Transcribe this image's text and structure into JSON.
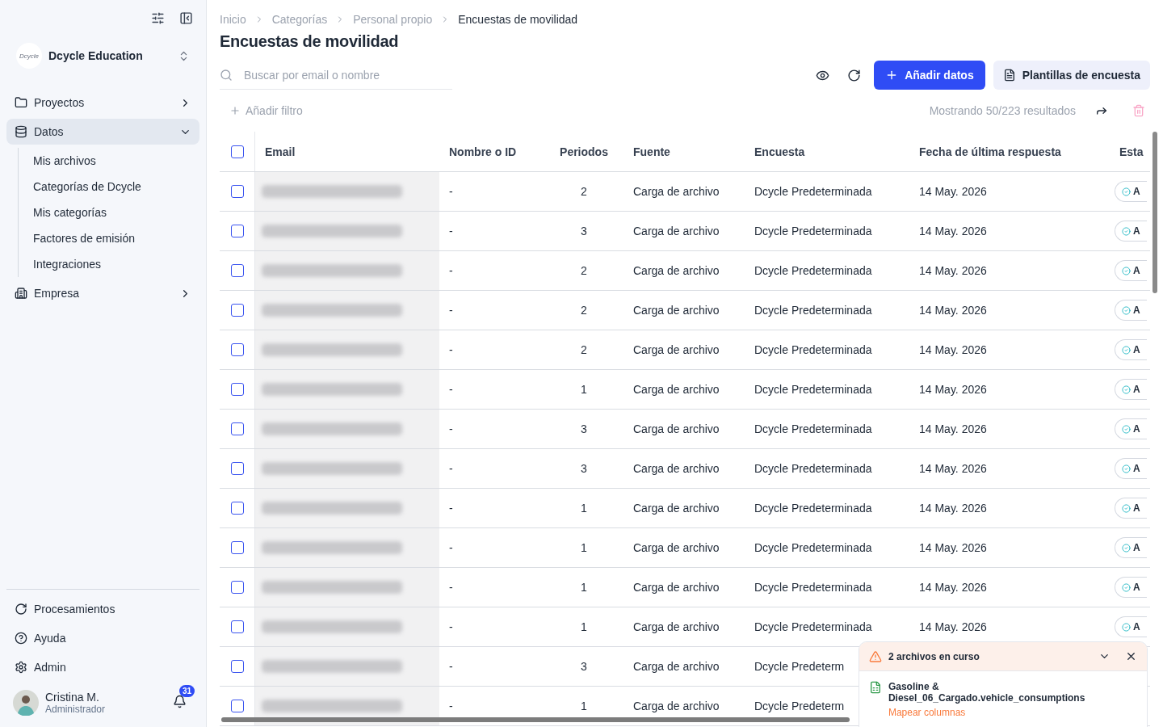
{
  "sidebar": {
    "org": {
      "logo_text": "Dcycle",
      "name": "Dcycle Education"
    },
    "nav": [
      {
        "label": "Proyectos",
        "kind": "folder",
        "expanded": false,
        "selected": false
      },
      {
        "label": "Datos",
        "kind": "database",
        "expanded": true,
        "selected": true,
        "children": [
          {
            "label": "Mis archivos"
          },
          {
            "label": "Categorías de Dcycle"
          },
          {
            "label": "Mis categorías"
          },
          {
            "label": "Factores de emisión"
          },
          {
            "label": "Integraciones"
          }
        ]
      },
      {
        "label": "Empresa",
        "kind": "building",
        "expanded": false,
        "selected": false
      }
    ],
    "bottom": [
      {
        "label": "Procesamientos",
        "kind": "refresh"
      },
      {
        "label": "Ayuda",
        "kind": "help"
      },
      {
        "label": "Admin",
        "kind": "settings"
      }
    ],
    "user": {
      "name": "Cristina M.",
      "role": "Administrador",
      "notifications": "31"
    }
  },
  "breadcrumb": [
    "Inicio",
    "Categorías",
    "Personal propio",
    "Encuestas de movilidad"
  ],
  "title": "Encuestas de movilidad",
  "search": {
    "placeholder": "Buscar por email o nombre"
  },
  "buttons": {
    "primary": "Añadir datos",
    "secondary": "Plantillas de encuesta"
  },
  "filter": "Añadir filtro",
  "results": "Mostrando 50/223 resultados",
  "table": {
    "select_all": false,
    "columns": [
      "Email",
      "Nombre o ID",
      "Periodos",
      "Fuente",
      "Encuesta",
      "Fecha de última respuesta",
      "Esta"
    ],
    "rows": [
      {
        "checked": false,
        "email_blurred": true,
        "name": "-",
        "periods": "2",
        "source": "Carga de archivo",
        "survey": "Dcycle Predeterminada",
        "date": "14 May. 2026",
        "status": "A"
      },
      {
        "checked": false,
        "email_blurred": true,
        "name": "-",
        "periods": "3",
        "source": "Carga de archivo",
        "survey": "Dcycle Predeterminada",
        "date": "14 May. 2026",
        "status": "A"
      },
      {
        "checked": false,
        "email_blurred": true,
        "name": "-",
        "periods": "2",
        "source": "Carga de archivo",
        "survey": "Dcycle Predeterminada",
        "date": "14 May. 2026",
        "status": "A"
      },
      {
        "checked": false,
        "email_blurred": true,
        "name": "-",
        "periods": "2",
        "source": "Carga de archivo",
        "survey": "Dcycle Predeterminada",
        "date": "14 May. 2026",
        "status": "A"
      },
      {
        "checked": false,
        "email_blurred": true,
        "name": "-",
        "periods": "2",
        "source": "Carga de archivo",
        "survey": "Dcycle Predeterminada",
        "date": "14 May. 2026",
        "status": "A"
      },
      {
        "checked": false,
        "email_blurred": true,
        "name": "-",
        "periods": "1",
        "source": "Carga de archivo",
        "survey": "Dcycle Predeterminada",
        "date": "14 May. 2026",
        "status": "A"
      },
      {
        "checked": false,
        "email_blurred": true,
        "name": "-",
        "periods": "3",
        "source": "Carga de archivo",
        "survey": "Dcycle Predeterminada",
        "date": "14 May. 2026",
        "status": "A"
      },
      {
        "checked": false,
        "email_blurred": true,
        "name": "-",
        "periods": "3",
        "source": "Carga de archivo",
        "survey": "Dcycle Predeterminada",
        "date": "14 May. 2026",
        "status": "A"
      },
      {
        "checked": false,
        "email_blurred": true,
        "name": "-",
        "periods": "1",
        "source": "Carga de archivo",
        "survey": "Dcycle Predeterminada",
        "date": "14 May. 2026",
        "status": "A"
      },
      {
        "checked": false,
        "email_blurred": true,
        "name": "-",
        "periods": "1",
        "source": "Carga de archivo",
        "survey": "Dcycle Predeterminada",
        "date": "14 May. 2026",
        "status": "A"
      },
      {
        "checked": false,
        "email_blurred": true,
        "name": "-",
        "periods": "1",
        "source": "Carga de archivo",
        "survey": "Dcycle Predeterminada",
        "date": "14 May. 2026",
        "status": "A"
      },
      {
        "checked": false,
        "email_blurred": true,
        "name": "-",
        "periods": "1",
        "source": "Carga de archivo",
        "survey": "Dcycle Predeterminada",
        "date": "14 May. 2026",
        "status": "A"
      },
      {
        "checked": false,
        "email_blurred": true,
        "name": "-",
        "periods": "3",
        "source": "Carga de archivo",
        "survey": "Dcycle Predeterm"
      },
      {
        "checked": false,
        "email_blurred": true,
        "name": "-",
        "periods": "1",
        "source": "Carga de archivo",
        "survey": "Dcycle Predeterm"
      }
    ]
  },
  "upload_panel": {
    "title": "2 archivos en curso",
    "file": "Gasoline & Diesel_06_Cargado.vehicle_consumptions",
    "action": "Mapear columnas"
  }
}
